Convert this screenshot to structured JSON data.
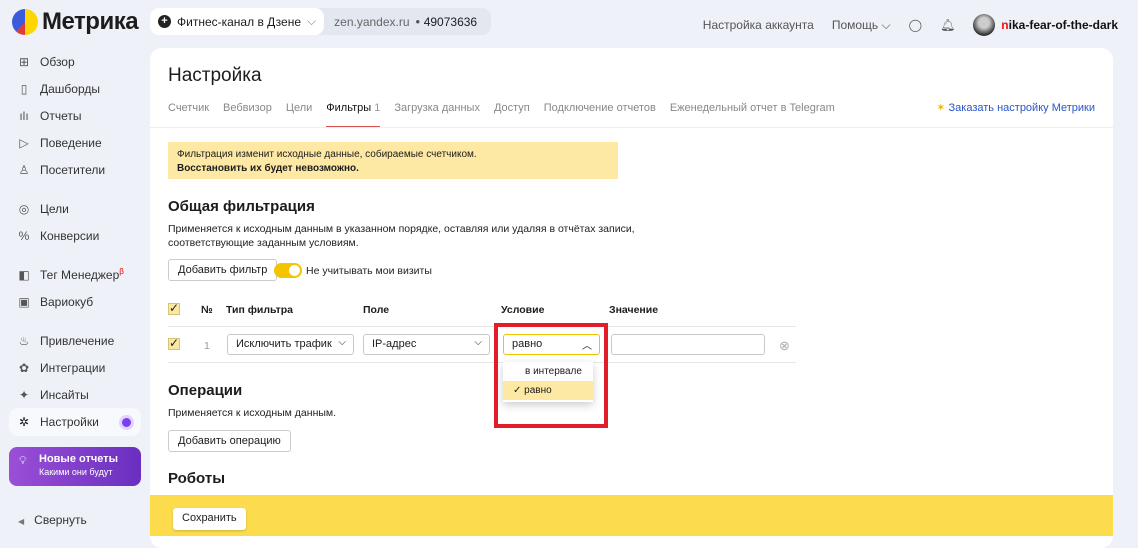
{
  "header": {
    "logo": "Метрика",
    "counter_name": "Фитнес-канал в Дзене",
    "counter_host": "zen.yandex.ru",
    "counter_id": "49073636",
    "account_settings": "Настройка аккаунта",
    "help": "Помощь",
    "user_first": "n",
    "user_rest": "ika-fear-of-the-dark"
  },
  "sidebar": {
    "items": [
      {
        "label": "Обзор"
      },
      {
        "label": "Дашборды"
      },
      {
        "label": "Отчеты"
      },
      {
        "label": "Поведение"
      },
      {
        "label": "Посетители"
      },
      {
        "label": "Цели"
      },
      {
        "label": "Конверсии"
      },
      {
        "label": "Тег Менеджер",
        "badge": "β"
      },
      {
        "label": "Вариокуб"
      },
      {
        "label": "Привлечение"
      },
      {
        "label": "Интеграции"
      },
      {
        "label": "Инсайты"
      },
      {
        "label": "Настройки"
      }
    ],
    "promo_title": "Новые отчеты",
    "promo_sub": "Какими они будут",
    "collapse": "Свернуть"
  },
  "page": {
    "title": "Настройка",
    "tabs": [
      "Счетчик",
      "Вебвизор",
      "Цели",
      "Фильтры",
      "Загрузка данных",
      "Доступ",
      "Подключение отчетов",
      "Еженедельный отчет в Telegram"
    ],
    "filters_count": "1",
    "order_link": "Заказать настройку Метрики",
    "warning_line1": "Фильтрация изменит исходные данные, собираемые счетчиком.",
    "warning_line2": "Восстановить их будет невозможно.",
    "general_title": "Общая фильтрация",
    "general_desc1": "Применяется к исходным данным в указанном порядке, оставляя или удаляя в отчётах записи,",
    "general_desc2": "соответствующие заданным условиям.",
    "add_filter": "Добавить фильтр",
    "ignore_visits": "Не учитывать мои визиты",
    "columns": [
      "№",
      "Тип фильтра",
      "Поле",
      "Условие",
      "Значение"
    ],
    "row": {
      "num": "1",
      "type": "Исключить трафик",
      "field": "IP-адрес",
      "condition": "равно",
      "value": ""
    },
    "condition_options": [
      "в интервале",
      "равно"
    ],
    "ops_title": "Операции",
    "ops_desc": "Применяется к исходным данным.",
    "add_op": "Добавить операцию",
    "robots_title": "Роботы",
    "save": "Сохранить"
  }
}
